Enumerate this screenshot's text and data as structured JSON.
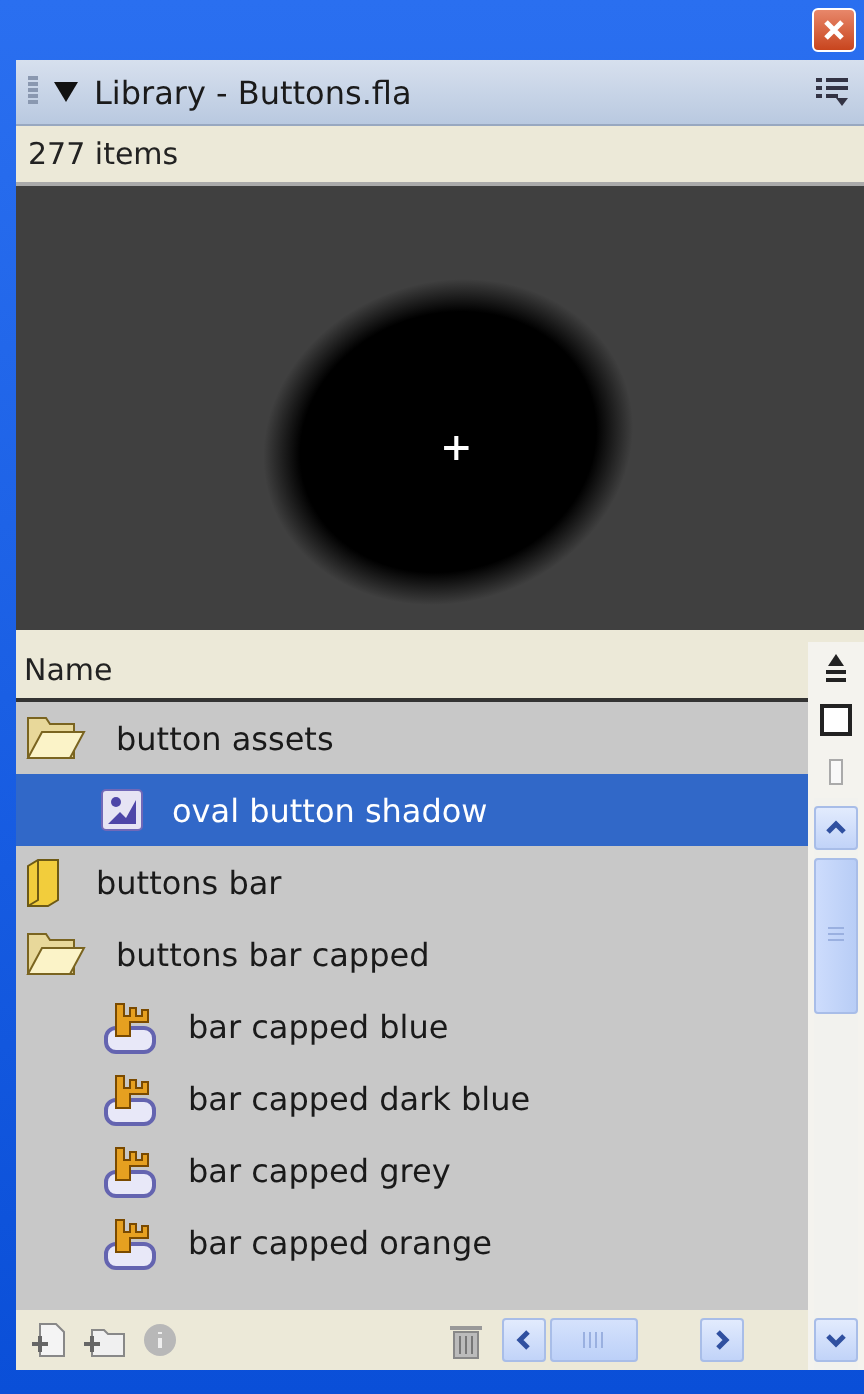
{
  "panel": {
    "title": "Library - Buttons.fla",
    "expanded": true
  },
  "status": "277 items",
  "table": {
    "columns": [
      "Name"
    ],
    "rows": [
      {
        "kind": "folder",
        "label": "button assets",
        "expanded": true,
        "selected": false,
        "children": [
          {
            "kind": "graphic",
            "label": "oval button shadow",
            "selected": true
          }
        ]
      },
      {
        "kind": "folder",
        "label": "buttons bar",
        "expanded": false,
        "selected": false
      },
      {
        "kind": "folder",
        "label": "buttons bar capped",
        "expanded": true,
        "selected": false,
        "children": [
          {
            "kind": "button",
            "label": "bar capped blue",
            "selected": false
          },
          {
            "kind": "button",
            "label": "bar capped dark blue",
            "selected": false
          },
          {
            "kind": "button",
            "label": "bar capped grey",
            "selected": false
          },
          {
            "kind": "button",
            "label": "bar capped orange",
            "selected": false
          }
        ]
      }
    ]
  }
}
